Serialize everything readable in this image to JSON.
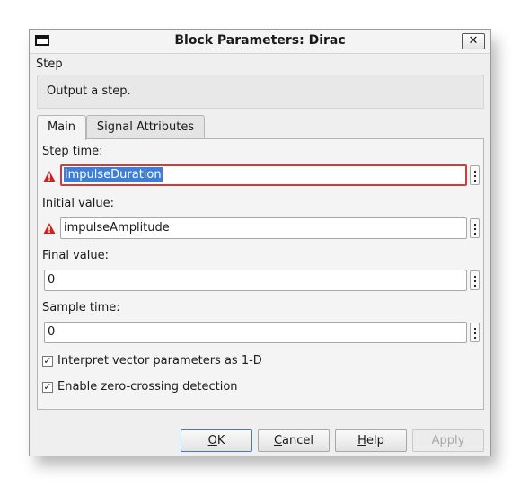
{
  "window": {
    "title": "Block Parameters: Dirac"
  },
  "block": {
    "name": "Step",
    "description": "Output a step."
  },
  "tabs": [
    {
      "label": "Main",
      "active": true
    },
    {
      "label": "Signal Attributes",
      "active": false
    }
  ],
  "params": {
    "step_time": {
      "label": "Step time:",
      "value": "impulseDuration",
      "error": true
    },
    "initial_value": {
      "label": "Initial value:",
      "value": "impulseAmplitude",
      "error": false,
      "warning": true
    },
    "final_value": {
      "label": "Final value:",
      "value": "0"
    },
    "sample_time": {
      "label": "Sample time:",
      "value": "0"
    }
  },
  "options": {
    "interpret_vector": {
      "label": "Interpret vector parameters as 1-D",
      "checked": true
    },
    "zero_crossing": {
      "label": "Enable zero-crossing detection",
      "checked": true
    }
  },
  "buttons": {
    "ok": {
      "mnemonic": "O",
      "rest": "K"
    },
    "cancel": {
      "mnemonic": "C",
      "rest": "ancel"
    },
    "help": {
      "mnemonic": "H",
      "rest": "elp"
    },
    "apply": {
      "label": "Apply",
      "enabled": false
    }
  },
  "colors": {
    "error_border": "#d23b3b",
    "warning_icon": "#cc2222",
    "selection": "#3d7fd6"
  }
}
